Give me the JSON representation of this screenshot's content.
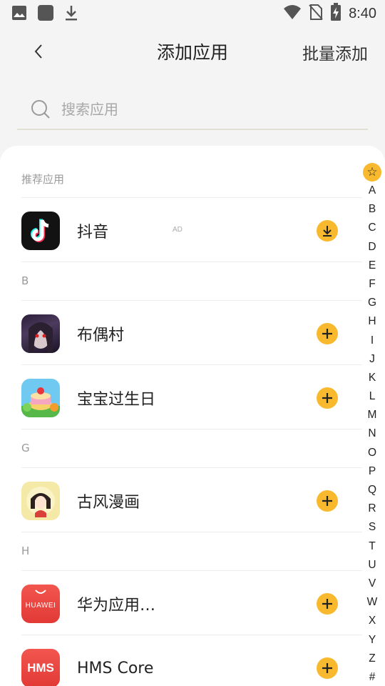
{
  "status_bar": {
    "time": "8:40",
    "left_icons": [
      "image-icon",
      "square-icon",
      "download-icon"
    ],
    "right_icons": [
      "wifi-icon",
      "no-sim-icon",
      "battery-charging-icon"
    ]
  },
  "header": {
    "title": "添加应用",
    "batch_add_label": "批量添加"
  },
  "search": {
    "placeholder": "搜索应用"
  },
  "sections": [
    {
      "header": "推荐应用"
    },
    {
      "header": "B"
    },
    {
      "header": "G"
    },
    {
      "header": "H"
    }
  ],
  "apps": [
    {
      "name": "抖音",
      "tag": "AD",
      "action": "download",
      "icon": "tiktok-icon"
    },
    {
      "name": "布偶村",
      "action": "add",
      "icon": "doll-village-icon"
    },
    {
      "name": "宝宝过生日",
      "action": "add",
      "icon": "baby-birthday-icon"
    },
    {
      "name": "古风漫画",
      "action": "add",
      "icon": "ancient-comic-icon"
    },
    {
      "name": "华为应用…",
      "action": "add",
      "icon": "huawei-appgallery-icon",
      "icon_text": "HUAWEI"
    },
    {
      "name": "HMS Core",
      "action": "add",
      "icon": "hms-core-icon",
      "icon_text": "HMS"
    }
  ],
  "alphabet_index": {
    "star": "☆",
    "letters": [
      "A",
      "B",
      "C",
      "D",
      "E",
      "F",
      "G",
      "H",
      "I",
      "J",
      "K",
      "L",
      "M",
      "N",
      "O",
      "P",
      "Q",
      "R",
      "S",
      "T",
      "U",
      "V",
      "W",
      "X",
      "Y",
      "Z",
      "#"
    ]
  },
  "colors": {
    "accent": "#f8b92f",
    "background": "#f4f4f4",
    "card": "#ffffff",
    "huawei_red": "#e63f3b"
  }
}
